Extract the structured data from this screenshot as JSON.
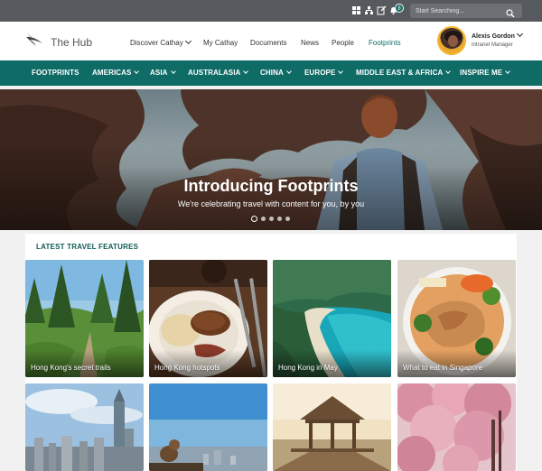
{
  "utility_bar": {
    "notification_count": "8",
    "search_placeholder": "Start Searching..."
  },
  "header": {
    "brand": "The Hub",
    "nav": [
      {
        "label": "Discover Cathay",
        "has_dropdown": true
      },
      {
        "label": "My Cathay"
      },
      {
        "label": "Documents"
      },
      {
        "label": "News"
      },
      {
        "label": "People"
      },
      {
        "label": "Footprints",
        "active": true
      }
    ],
    "user": {
      "name": "Alexis Gordon",
      "role": "Intranet Manager"
    }
  },
  "category_nav": [
    {
      "label": "FOOTPRINTS",
      "has_dropdown": false
    },
    {
      "label": "AMERICAS",
      "has_dropdown": true
    },
    {
      "label": "ASIA",
      "has_dropdown": true
    },
    {
      "label": "AUSTRALASIA",
      "has_dropdown": true
    },
    {
      "label": "CHINA",
      "has_dropdown": true
    },
    {
      "label": "EUROPE",
      "has_dropdown": true
    },
    {
      "label": "MIDDLE EAST & AFRICA",
      "has_dropdown": true
    },
    {
      "label": "INSPIRE ME",
      "has_dropdown": true
    }
  ],
  "hero": {
    "title": "Introducing Footprints",
    "subtitle": "We're celebrating travel with content for you, by you",
    "slide_count": 5,
    "active_slide": 1
  },
  "features": {
    "title": "LATEST TRAVEL FEATURES",
    "cards": [
      {
        "label": "Hong Kong's secret trails"
      },
      {
        "label": "Hong Kong hotspots"
      },
      {
        "label": "Hong Kong in May"
      },
      {
        "label": "What to eat in Singapore"
      },
      {
        "label": ""
      },
      {
        "label": ""
      },
      {
        "label": ""
      },
      {
        "label": ""
      }
    ]
  },
  "colors": {
    "accent": "#0f6b66",
    "utility_bar": "#56595d",
    "avatar_ring": "#f4b42f"
  }
}
